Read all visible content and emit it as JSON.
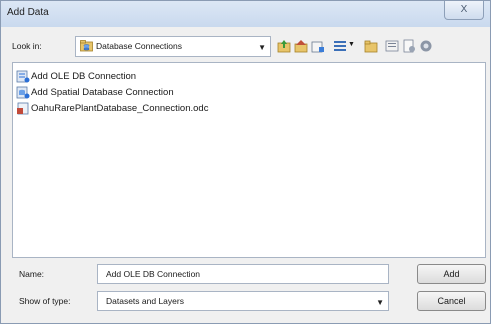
{
  "window": {
    "title": "Add Data",
    "close_label": "X"
  },
  "look_in": {
    "label": "Look in:",
    "value": "Database Connections"
  },
  "toolbar": {
    "icons": [
      "up-one-level-icon",
      "home-icon",
      "connect-folder-icon",
      "view-menu-icon",
      "new-folder-icon",
      "details-icon",
      "options-icon",
      "catalog-icon"
    ]
  },
  "items": [
    {
      "label": "Add OLE DB Connection",
      "icon": "ole-db-connection-icon"
    },
    {
      "label": "Add Spatial Database Connection",
      "icon": "spatial-db-connection-icon"
    },
    {
      "label": "OahuRarePlantDatabase_Connection.odc",
      "icon": "odc-file-icon"
    }
  ],
  "name": {
    "label": "Name:",
    "value": "Add OLE DB Connection"
  },
  "show_of_type": {
    "label": "Show of type:",
    "value": "Datasets and Layers"
  },
  "buttons": {
    "add": "Add",
    "cancel": "Cancel"
  },
  "colors": {
    "accent": "#2b6fd6",
    "window_bg": "#f0f0f0",
    "title_bar": "#d4e1f2"
  }
}
